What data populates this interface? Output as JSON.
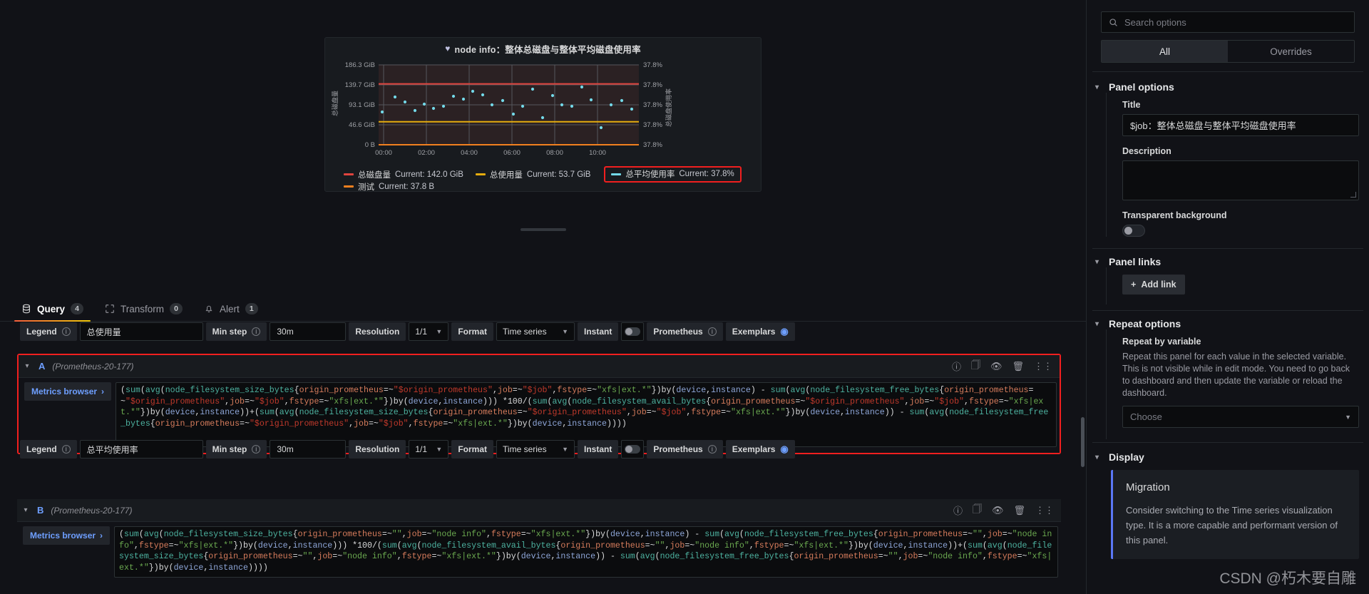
{
  "panel": {
    "heart_icon": "heart-icon",
    "title": "node info：整体总磁盘与整体平均磁盘使用率"
  },
  "chart_data": {
    "type": "scatter",
    "title": "node info：整体总磁盘与整体平均磁盘使用率",
    "xlabel": "",
    "ylabel": "总磁盘量",
    "y2label": "总磁盘使用率",
    "grid": true,
    "legend_position": "bottom",
    "y_left_ticks": [
      "0 B",
      "46.6 GiB",
      "93.1 GiB",
      "139.7 GiB",
      "186.3 GiB"
    ],
    "y_left_values": [
      0,
      46.6,
      93.1,
      139.7,
      186.3
    ],
    "y_right_ticks": [
      "37.8%",
      "37.8%",
      "37.8%",
      "37.8%",
      "37.8%"
    ],
    "x_ticks": [
      "00:00",
      "02:00",
      "04:00",
      "06:00",
      "08:00",
      "10:00"
    ],
    "ylim": [
      0,
      186.3
    ],
    "series": [
      {
        "name": "总磁盘量",
        "color": "#e0443e",
        "type": "line",
        "current": "142.0 GiB",
        "value": 142.0
      },
      {
        "name": "总使用量",
        "color": "#e5ac0e",
        "type": "line",
        "current": "53.7 GiB",
        "value": 53.7
      },
      {
        "name": "总平均使用率",
        "color": "#73d9e8",
        "type": "scatter",
        "current": "37.8%",
        "value": 37.8,
        "points": [
          80.5,
          110.0,
          100.0,
          69.5,
          93.5,
          110.5,
          83.4,
          97.5,
          113.5,
          88.5,
          102.0,
          92.5,
          119.5,
          81.0,
          107.5,
          93.5,
          97.0,
          121.0,
          78.0,
          106.0,
          100.5,
          60.0,
          95.0,
          112.0,
          86.0
        ]
      },
      {
        "name": "测试",
        "color": "#f2801f",
        "type": "line",
        "current": "37.8 B",
        "value": 0
      }
    ],
    "legend_rows": [
      [
        {
          "name": "总磁盘量",
          "stat": "Current: 142.0 GiB",
          "color": "#e0443e",
          "highlight": false
        },
        {
          "name": "总使用量",
          "stat": "Current: 53.7 GiB",
          "color": "#e5ac0e",
          "highlight": false
        },
        {
          "name": "总平均使用率",
          "stat": "Current: 37.8%",
          "color": "#73d9e8",
          "highlight": true
        }
      ],
      [
        {
          "name": "测试",
          "stat": "Current: 37.8 B",
          "color": "#f2801f",
          "highlight": false
        }
      ]
    ]
  },
  "tabs": [
    {
      "label": "Query",
      "count": "4",
      "icon": "database-icon",
      "active": true
    },
    {
      "label": "Transform",
      "count": "0",
      "icon": "transform-icon",
      "active": false
    },
    {
      "label": "Alert",
      "count": "1",
      "icon": "bell-icon",
      "active": false
    }
  ],
  "query_options_a": {
    "legend_label": "Legend",
    "legend_value": "总使用量",
    "min_step_label": "Min step",
    "min_step_value": "30m",
    "resolution_label": "Resolution",
    "resolution_value": "1/1",
    "format_label": "Format",
    "format_value": "Time series",
    "instant_label": "Instant",
    "instant_on": false,
    "datasource_label": "Prometheus",
    "exemplars_label": "Exemplars"
  },
  "query_options_b": {
    "legend_label": "Legend",
    "legend_value": "总平均使用率",
    "min_step_label": "Min step",
    "min_step_value": "30m",
    "resolution_label": "Resolution",
    "resolution_value": "1/1",
    "format_label": "Format",
    "format_value": "Time series",
    "instant_label": "Instant",
    "instant_on": false,
    "datasource_label": "Prometheus",
    "exemplars_label": "Exemplars"
  },
  "queries": [
    {
      "ref_id": "A",
      "datasource": "(Prometheus-20-177)",
      "metrics_browser_label": "Metrics browser",
      "highlighted": true,
      "expr": "(sum(avg(node_filesystem_size_bytes{origin_prometheus=~\"$origin_prometheus\",job=~\"$job\",fstype=~\"xfs|ext.*\"})by(device,instance) - sum(avg(node_filesystem_free_bytes{origin_prometheus=~\"$origin_prometheus\",job=~\"$job\",fstype=~\"xfs|ext.*\"})by(device,instance))) *100/(sum(avg(node_filesystem_avail_bytes{origin_prometheus=~\"$origin_prometheus\",job=~\"$job\",fstype=~\"xfs|ext.*\"})by(device,instance))+(sum(avg(node_filesystem_size_bytes{origin_prometheus=~\"$origin_prometheus\",job=~\"$job\",fstype=~\"xfs|ext.*\"})by(device,instance)) - sum(avg(node_filesystem_free_bytes{origin_prometheus=~\"$origin_prometheus\",job=~\"$job\",fstype=~\"xfs|ext.*\"})by(device,instance))))"
    },
    {
      "ref_id": "B",
      "datasource": "(Prometheus-20-177)",
      "metrics_browser_label": "Metrics browser",
      "highlighted": false,
      "expr": "(sum(avg(node_filesystem_size_bytes{origin_prometheus=~\"\",job=~\"node info\",fstype=~\"xfs|ext.*\"})by(device,instance) - sum(avg(node_filesystem_free_bytes{origin_prometheus=~\"\",job=~\"node info\",fstype=~\"xfs|ext.*\"})by(device,instance))) *100/(sum(avg(node_filesystem_avail_bytes{origin_prometheus=~\"\",job=~\"node info\",fstype=~\"xfs|ext.*\"})by(device,instance))+(sum(avg(node_filesystem_size_bytes{origin_prometheus=~\"\",job=~\"node info\",fstype=~\"xfs|ext.*\"})by(device,instance)) - sum(avg(node_filesystem_free_bytes{origin_prometheus=~\"\",job=~\"node info\",fstype=~\"xfs|ext.*\"})by(device,instance))))"
    }
  ],
  "options_pane": {
    "search_placeholder": "Search options",
    "segments": [
      {
        "label": "All",
        "active": true
      },
      {
        "label": "Overrides",
        "active": false
      }
    ],
    "panel_options": {
      "section_title": "Panel options",
      "title_label": "Title",
      "title_value": "$job：整体总磁盘与整体平均磁盘使用率",
      "description_label": "Description",
      "description_value": "",
      "transparent_label": "Transparent background",
      "transparent_on": false
    },
    "panel_links": {
      "section_title": "Panel links",
      "add_link_label": "Add link"
    },
    "repeat_options": {
      "section_title": "Repeat options",
      "field_label": "Repeat by variable",
      "help_text": "Repeat this panel for each value in the selected variable. This is not visible while in edit mode. You need to go back to dashboard and then update the variable or reload the dashboard.",
      "select_value": "Choose"
    },
    "display": {
      "section_title": "Display",
      "migration_title": "Migration",
      "migration_text": "Consider switching to the Time series visualization type. It is a more capable and performant version of this panel."
    }
  },
  "watermark": "CSDN @朽木要自雕",
  "colors": {
    "accent_blue": "#6e9fff",
    "highlight_red": "#f11f1f",
    "tab_underline": "#f55f3e",
    "plot_bg": "#2b2123"
  }
}
